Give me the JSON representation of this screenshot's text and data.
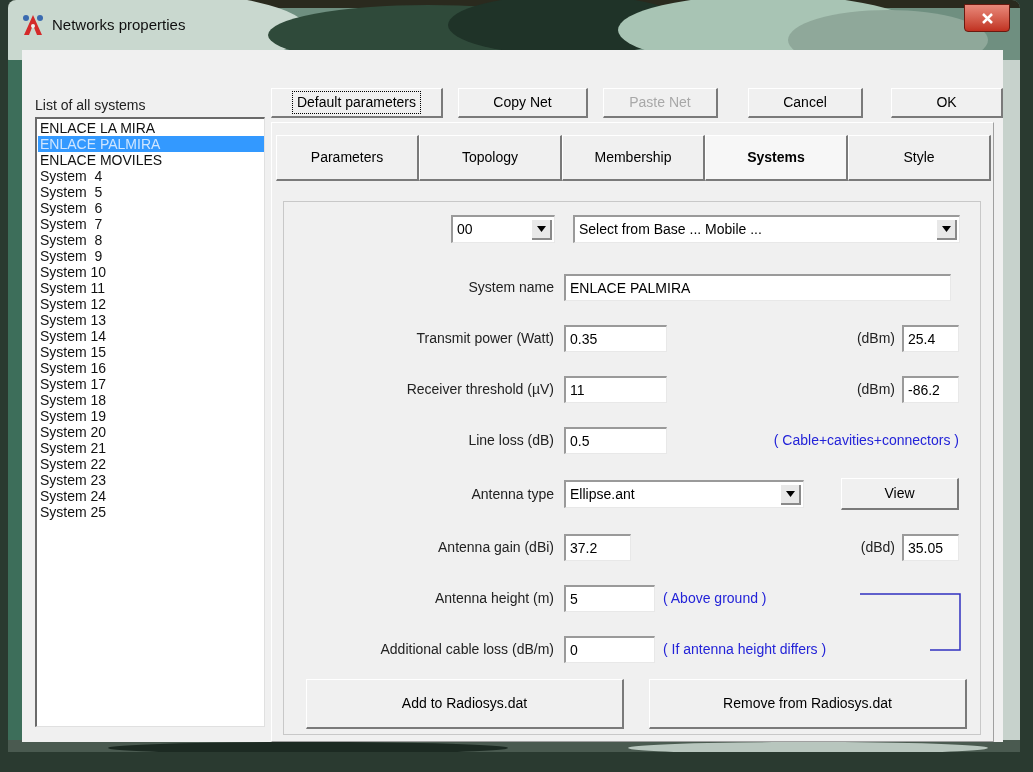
{
  "window": {
    "title": "Networks properties"
  },
  "systems_list": {
    "label": "List of all systems",
    "items": [
      {
        "text": "ENLACE LA MIRA",
        "selected": false
      },
      {
        "text": "ENLACE PALMIRA",
        "selected": true
      },
      {
        "text": "ENLACE MOVILES",
        "selected": false
      },
      {
        "text": "System  4",
        "selected": false
      },
      {
        "text": "System  5",
        "selected": false
      },
      {
        "text": "System  6",
        "selected": false
      },
      {
        "text": "System  7",
        "selected": false
      },
      {
        "text": "System  8",
        "selected": false
      },
      {
        "text": "System  9",
        "selected": false
      },
      {
        "text": "System 10",
        "selected": false
      },
      {
        "text": "System 11",
        "selected": false
      },
      {
        "text": "System 12",
        "selected": false
      },
      {
        "text": "System 13",
        "selected": false
      },
      {
        "text": "System 14",
        "selected": false
      },
      {
        "text": "System 15",
        "selected": false
      },
      {
        "text": "System 16",
        "selected": false
      },
      {
        "text": "System 17",
        "selected": false
      },
      {
        "text": "System 18",
        "selected": false
      },
      {
        "text": "System 19",
        "selected": false
      },
      {
        "text": "System 20",
        "selected": false
      },
      {
        "text": "System 21",
        "selected": false
      },
      {
        "text": "System 22",
        "selected": false
      },
      {
        "text": "System 23",
        "selected": false
      },
      {
        "text": "System 24",
        "selected": false
      },
      {
        "text": "System 25",
        "selected": false
      }
    ]
  },
  "buttons": [
    {
      "label": "Default parameters",
      "focused": true,
      "disabled": false
    },
    {
      "label": "Copy Net",
      "focused": false,
      "disabled": false
    },
    {
      "label": "Paste Net",
      "focused": false,
      "disabled": true
    },
    {
      "label": "Cancel",
      "focused": false,
      "disabled": false
    },
    {
      "label": "OK",
      "focused": false,
      "disabled": false
    }
  ],
  "tabs": [
    {
      "label": "Parameters",
      "selected": false
    },
    {
      "label": "Topology",
      "selected": false
    },
    {
      "label": "Membership",
      "selected": false
    },
    {
      "label": "Systems",
      "selected": true
    },
    {
      "label": "Style",
      "selected": false
    }
  ],
  "form": {
    "index_select": {
      "value": "00"
    },
    "base_select": {
      "value": "Select from Base ... Mobile ..."
    },
    "rows": [
      {
        "kind": "text",
        "label": "System name",
        "value": "ENLACE PALMIRA"
      },
      {
        "kind": "pair",
        "label": "Transmit power (Watt)",
        "value": "0.35",
        "unit": "(dBm)",
        "unit_value": "25.4"
      },
      {
        "kind": "pair",
        "label": "Receiver threshold (µV)",
        "value": "11",
        "unit": "(dBm)",
        "unit_value": "-86.2"
      },
      {
        "kind": "note",
        "label": "Line loss (dB)",
        "value": "0.5",
        "note": "( Cable+cavities+connectors )"
      },
      {
        "kind": "select",
        "label": "Antenna type",
        "value": "Ellipse.ant",
        "button": "View"
      },
      {
        "kind": "pair",
        "label": "Antenna gain (dBi)",
        "value": "37.2",
        "unit": "(dBd)",
        "unit_value": "35.05"
      },
      {
        "kind": "note",
        "label": "Antenna height (m)",
        "value": "5",
        "note": "( Above ground )"
      },
      {
        "kind": "note",
        "label": "Additional cable loss (dB/m)",
        "value": "0",
        "note": "( If antenna height differs )"
      }
    ],
    "actions": [
      "Add to Radiosys.dat",
      "Remove from Radiosys.dat"
    ]
  }
}
